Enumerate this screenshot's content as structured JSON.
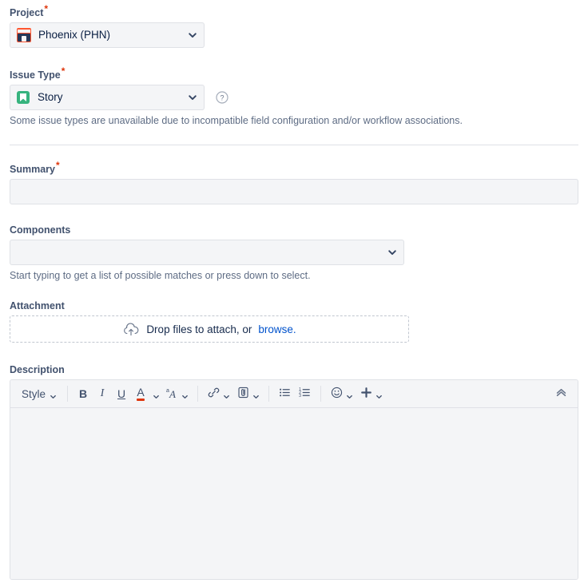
{
  "form": {
    "project": {
      "label": "Project",
      "required": true,
      "value": "Phoenix (PHN)",
      "icon": "project-avatar-icon",
      "icon_color": "#ff5630"
    },
    "issue_type": {
      "label": "Issue Type",
      "required": true,
      "value": "Story",
      "icon": "story-icon",
      "icon_color": "#36b37e",
      "help_icon": "question-circle-icon",
      "help_text": "Some issue types are unavailable due to incompatible field configuration and/or workflow associations."
    },
    "summary": {
      "label": "Summary",
      "required": true,
      "value": "",
      "placeholder": ""
    },
    "components": {
      "label": "Components",
      "required": false,
      "value": "",
      "placeholder": "",
      "help_text": "Start typing to get a list of possible matches or press down to select."
    },
    "attachment": {
      "label": "Attachment",
      "required": false,
      "dropzone_icon": "cloud-upload-icon",
      "dropzone_text": "Drop files to attach, or",
      "browse_link": "browse",
      "dropzone_suffix": ".",
      "link_color": "#0052cc"
    },
    "description": {
      "label": "Description",
      "required": false,
      "toolbar": {
        "style_label": "Style",
        "bold_label": "B",
        "italic_label": "I",
        "underline_label": "U",
        "text_color_label": "A",
        "text_color_swatch": "#de350b",
        "more_format_label": "A",
        "link_icon": "link-icon",
        "attach_icon": "paperclip-box-icon",
        "bullet_list_icon": "bullet-list-icon",
        "numbered_list_icon": "numbered-list-icon",
        "emoji_icon": "emoji-icon",
        "insert_icon": "plus-icon",
        "collapse_icon": "double-chevron-up-icon"
      },
      "body_value": ""
    }
  },
  "theme": {
    "field_bg": "#f4f5f7",
    "border": "#dfe1e6",
    "label_color": "#42526e",
    "required_color": "#de350b",
    "help_color": "#5e6c84"
  }
}
